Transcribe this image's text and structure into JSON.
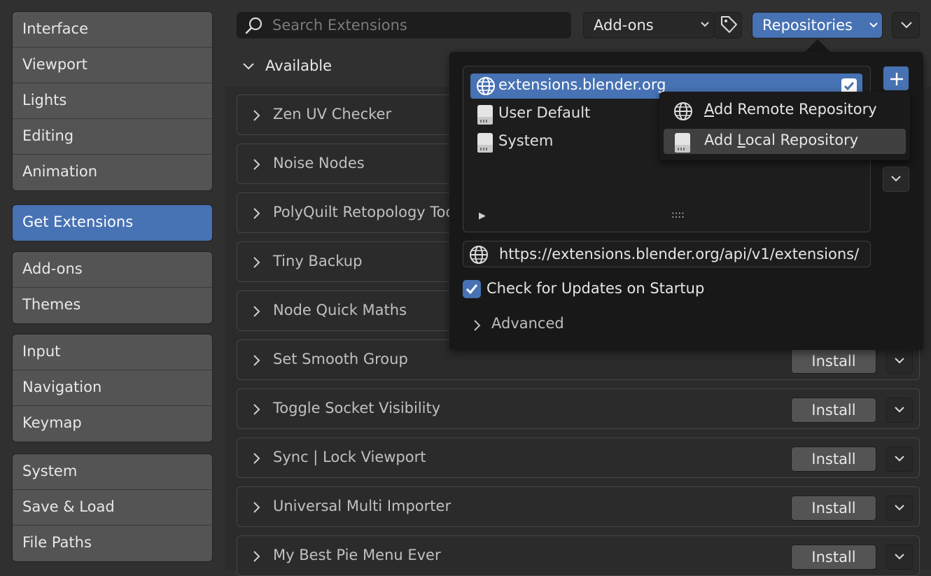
{
  "sidebar": {
    "groups": [
      [
        "Interface",
        "Viewport",
        "Lights",
        "Editing",
        "Animation"
      ],
      [
        "Get Extensions"
      ],
      [
        "Add-ons",
        "Themes"
      ],
      [
        "Input",
        "Navigation",
        "Keymap"
      ],
      [
        "System",
        "Save & Load",
        "File Paths"
      ]
    ],
    "active": "Get Extensions"
  },
  "header": {
    "search_placeholder": "Search Extensions",
    "type_dropdown": "Add-ons",
    "repositories_button": "Repositories"
  },
  "section": {
    "label": "Available"
  },
  "extensions": [
    {
      "name": "Zen UV Checker"
    },
    {
      "name": "Noise Nodes"
    },
    {
      "name": "PolyQuilt Retopology Tool"
    },
    {
      "name": "Tiny Backup"
    },
    {
      "name": "Node Quick Maths"
    },
    {
      "name": "Set Smooth Group",
      "action": "Install"
    },
    {
      "name": "Toggle Socket Visibility",
      "action": "Install"
    },
    {
      "name": "Sync | Lock Viewport",
      "action": "Install"
    },
    {
      "name": "Universal Multi Importer",
      "action": "Install"
    },
    {
      "name": "My Best Pie Menu Ever",
      "action": "Install"
    }
  ],
  "repo_popover": {
    "repositories": [
      {
        "name": "extensions.blender.org",
        "icon": "globe-icon",
        "selected": true,
        "enabled": true
      },
      {
        "name": "User Default",
        "icon": "drive-icon"
      },
      {
        "name": "System",
        "icon": "drive-icon"
      }
    ],
    "url": "https://extensions.blender.org/api/v1/extensions/",
    "check_updates_label": "Check for Updates on Startup",
    "check_updates_value": true,
    "advanced_label": "Advanced"
  },
  "context_menu": {
    "items": [
      {
        "prefix": "",
        "accel": "A",
        "rest": "dd Remote Repository",
        "icon": "globe-icon"
      },
      {
        "prefix": "Add ",
        "accel": "L",
        "rest": "ocal Repository",
        "icon": "drive-icon",
        "hover": true
      }
    ]
  },
  "colors": {
    "accent": "#4772b3",
    "panel": "#303030",
    "popover": "#181818"
  }
}
